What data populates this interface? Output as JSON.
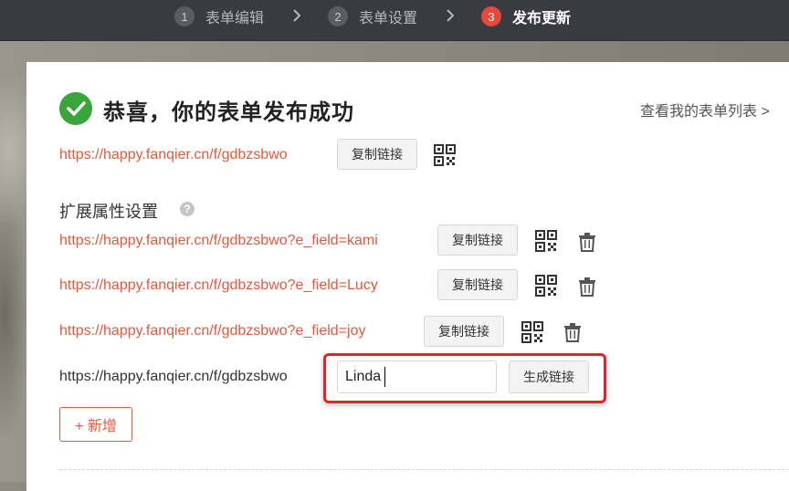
{
  "steps": [
    {
      "num": "1",
      "label": "表单编辑"
    },
    {
      "num": "2",
      "label": "表单设置"
    },
    {
      "num": "3",
      "label": "发布更新"
    }
  ],
  "success": {
    "title": "恭喜，你的表单发布成功",
    "view_list": "查看我的表单列表 >"
  },
  "main_link": {
    "url": "https://happy.fanqier.cn/f/gdbzsbwo",
    "copy_label": "复制链接"
  },
  "extension": {
    "title": "扩展属性设置",
    "help": "?",
    "links": [
      {
        "url": "https://happy.fanqier.cn/f/gdbzsbwo?e_field=kami",
        "copy_label": "复制链接"
      },
      {
        "url": "https://happy.fanqier.cn/f/gdbzsbwo?e_field=Lucy",
        "copy_label": "复制链接"
      },
      {
        "url": "https://happy.fanqier.cn/f/gdbzsbwo?e_field=joy",
        "copy_label": "复制链接"
      }
    ],
    "new_link_prefix": "https://happy.fanqier.cn/f/gdbzsbwo",
    "new_value": "Linda",
    "generate_label": "生成链接",
    "add_label": "+ 新增"
  },
  "colors": {
    "accent": "#e8573a",
    "success": "#3aa53a",
    "topbar": "#3a3b40",
    "highlight": "#e0242c"
  }
}
